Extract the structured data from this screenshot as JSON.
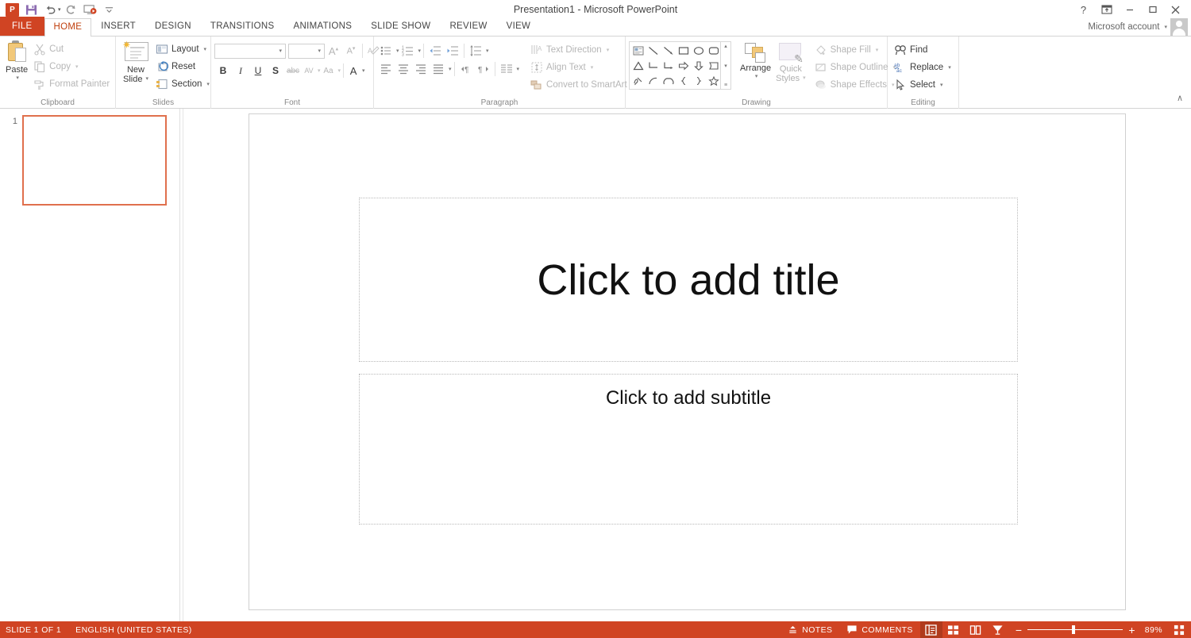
{
  "window": {
    "title": "Presentation1 - Microsoft PowerPoint",
    "help_label": "?",
    "ribbon_display_label": "ribbon-display-options",
    "minimize_label": "—",
    "restore_label": "❐",
    "close_label": "✕"
  },
  "quick_access": {
    "app_logo": "P",
    "items": [
      {
        "name": "save-icon",
        "label": "Save"
      },
      {
        "name": "undo-icon",
        "label": "Undo"
      },
      {
        "name": "redo-icon",
        "label": "Redo"
      },
      {
        "name": "start-slideshow-icon",
        "label": "Start From Beginning"
      },
      {
        "name": "customize-qat-icon",
        "label": "Customize Quick Access Toolbar"
      }
    ]
  },
  "account": {
    "label": "Microsoft account",
    "caret": "▾"
  },
  "tabs": [
    {
      "id": "file",
      "label": "FILE"
    },
    {
      "id": "home",
      "label": "HOME"
    },
    {
      "id": "insert",
      "label": "INSERT"
    },
    {
      "id": "design",
      "label": "DESIGN"
    },
    {
      "id": "transitions",
      "label": "TRANSITIONS"
    },
    {
      "id": "animations",
      "label": "ANIMATIONS"
    },
    {
      "id": "slideshow",
      "label": "SLIDE SHOW"
    },
    {
      "id": "review",
      "label": "REVIEW"
    },
    {
      "id": "view",
      "label": "VIEW"
    }
  ],
  "active_tab": "HOME",
  "ribbon": {
    "collapse_label": "∧",
    "clipboard": {
      "group_label": "Clipboard",
      "paste_label": "Paste",
      "paste_caret": "▾",
      "cut_label": "Cut",
      "copy_label": "Copy",
      "copy_caret": "▾",
      "format_painter_label": "Format Painter"
    },
    "slides": {
      "group_label": "Slides",
      "new_slide_label_line1": "New",
      "new_slide_label_line2": "Slide",
      "new_slide_caret": "▾",
      "layout_label": "Layout",
      "layout_caret": "▾",
      "reset_label": "Reset",
      "section_label": "Section",
      "section_caret": "▾"
    },
    "font": {
      "group_label": "Font",
      "font_name_value": "",
      "font_name_placeholder": "",
      "font_size_value": "",
      "font_size_placeholder": "",
      "grow_font_label": "A",
      "shrink_font_label": "A",
      "clear_formatting_label": "clear-formatting",
      "bold_label": "B",
      "italic_label": "I",
      "underline_label": "U",
      "shadow_label": "S",
      "strikethrough_label": "abc",
      "char_spacing_label": "AV",
      "change_case_label": "Aa",
      "font_color_label": "A"
    },
    "paragraph": {
      "group_label": "Paragraph",
      "bullets_label": "bullets",
      "numbering_label": "numbering",
      "decrease_indent_label": "decrease-indent",
      "increase_indent_label": "increase-indent",
      "line_spacing_label": "line-spacing",
      "align_left_label": "align-left",
      "align_center_label": "align-center",
      "align_right_label": "align-right",
      "justify_label": "justify",
      "ltr_label": "left-to-right",
      "rtl_label": "right-to-left",
      "columns_label": "columns",
      "text_direction_label": "Text Direction",
      "align_text_label": "Align Text",
      "convert_smartart_label": "Convert to SmartArt",
      "caret": "▾"
    },
    "drawing": {
      "group_label": "Drawing",
      "shapes": [
        "textbox",
        "line",
        "line-arrow",
        "rectangle",
        "oval",
        "rounded-rectangle",
        "triangle",
        "elbow-connector",
        "elbow-arrow-connector",
        "right-arrow",
        "down-arrow",
        "pentagon-flag",
        "scribble",
        "arc",
        "double-arc",
        "left-brace",
        "right-brace",
        "star"
      ],
      "gallery_up": "▴",
      "gallery_down": "▾",
      "gallery_more": "≡",
      "arrange_label": "Arrange",
      "arrange_caret": "▾",
      "quick_styles_line1": "Quick",
      "quick_styles_line2": "Styles",
      "quick_styles_caret": "▾",
      "shape_fill_label": "Shape Fill",
      "shape_outline_label": "Shape Outline",
      "shape_effects_label": "Shape Effects",
      "caret": "▾"
    },
    "editing": {
      "group_label": "Editing",
      "find_label": "Find",
      "replace_label": "Replace",
      "replace_caret": "▾",
      "select_label": "Select",
      "select_caret": "▾"
    }
  },
  "thumbnails": [
    {
      "number": "1",
      "selected": true
    }
  ],
  "slide": {
    "title_placeholder": "Click to add title",
    "subtitle_placeholder": "Click to add subtitle"
  },
  "status_bar": {
    "slide_count": "SLIDE 1 OF 1",
    "language": "ENGLISH (UNITED STATES)",
    "notes_label": "NOTES",
    "comments_label": "COMMENTS",
    "views": [
      {
        "name": "normal-view",
        "label": "Normal",
        "active": true
      },
      {
        "name": "slide-sorter-view",
        "label": "Slide Sorter",
        "active": false
      },
      {
        "name": "reading-view",
        "label": "Reading View",
        "active": false
      },
      {
        "name": "slide-show-view",
        "label": "Slide Show",
        "active": false
      }
    ],
    "zoom_out_label": "−",
    "zoom_in_label": "+",
    "zoom_value": "89%",
    "fit_window_label": "Fit slide to current window"
  },
  "colors": {
    "accent": "#d04423",
    "tab_active_text": "#c0400f",
    "thumb_border": "#e0704d",
    "statusbar_bg": "#d04423"
  }
}
